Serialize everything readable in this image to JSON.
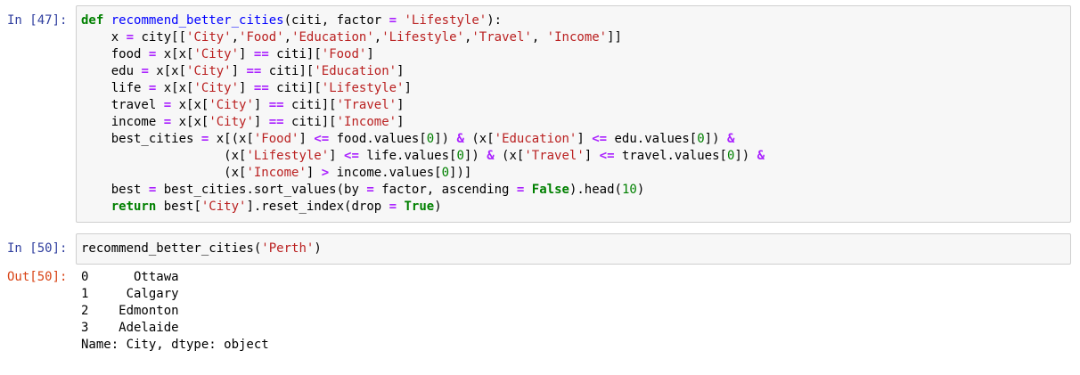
{
  "cells": [
    {
      "prompt": "In [47]:",
      "code_lines": [
        [
          {
            "t": "kw",
            "v": "def"
          },
          {
            "t": "",
            "v": " "
          },
          {
            "t": "fn",
            "v": "recommend_better_cities"
          },
          {
            "t": "",
            "v": "(citi, factor "
          },
          {
            "t": "op",
            "v": "="
          },
          {
            "t": "",
            "v": " "
          },
          {
            "t": "str",
            "v": "'Lifestyle'"
          },
          {
            "t": "",
            "v": "):"
          }
        ],
        [
          {
            "t": "",
            "v": "    x "
          },
          {
            "t": "op",
            "v": "="
          },
          {
            "t": "",
            "v": " city[["
          },
          {
            "t": "str",
            "v": "'City'"
          },
          {
            "t": "",
            "v": ","
          },
          {
            "t": "str",
            "v": "'Food'"
          },
          {
            "t": "",
            "v": ","
          },
          {
            "t": "str",
            "v": "'Education'"
          },
          {
            "t": "",
            "v": ","
          },
          {
            "t": "str",
            "v": "'Lifestyle'"
          },
          {
            "t": "",
            "v": ","
          },
          {
            "t": "str",
            "v": "'Travel'"
          },
          {
            "t": "",
            "v": ", "
          },
          {
            "t": "str",
            "v": "'Income'"
          },
          {
            "t": "",
            "v": "]]"
          }
        ],
        [
          {
            "t": "",
            "v": "    food "
          },
          {
            "t": "op",
            "v": "="
          },
          {
            "t": "",
            "v": " x[x["
          },
          {
            "t": "str",
            "v": "'City'"
          },
          {
            "t": "",
            "v": "] "
          },
          {
            "t": "op",
            "v": "=="
          },
          {
            "t": "",
            "v": " citi]["
          },
          {
            "t": "str",
            "v": "'Food'"
          },
          {
            "t": "",
            "v": "]"
          }
        ],
        [
          {
            "t": "",
            "v": "    edu "
          },
          {
            "t": "op",
            "v": "="
          },
          {
            "t": "",
            "v": " x[x["
          },
          {
            "t": "str",
            "v": "'City'"
          },
          {
            "t": "",
            "v": "] "
          },
          {
            "t": "op",
            "v": "=="
          },
          {
            "t": "",
            "v": " citi]["
          },
          {
            "t": "str",
            "v": "'Education'"
          },
          {
            "t": "",
            "v": "]"
          }
        ],
        [
          {
            "t": "",
            "v": "    life "
          },
          {
            "t": "op",
            "v": "="
          },
          {
            "t": "",
            "v": " x[x["
          },
          {
            "t": "str",
            "v": "'City'"
          },
          {
            "t": "",
            "v": "] "
          },
          {
            "t": "op",
            "v": "=="
          },
          {
            "t": "",
            "v": " citi]["
          },
          {
            "t": "str",
            "v": "'Lifestyle'"
          },
          {
            "t": "",
            "v": "]"
          }
        ],
        [
          {
            "t": "",
            "v": "    travel "
          },
          {
            "t": "op",
            "v": "="
          },
          {
            "t": "",
            "v": " x[x["
          },
          {
            "t": "str",
            "v": "'City'"
          },
          {
            "t": "",
            "v": "] "
          },
          {
            "t": "op",
            "v": "=="
          },
          {
            "t": "",
            "v": " citi]["
          },
          {
            "t": "str",
            "v": "'Travel'"
          },
          {
            "t": "",
            "v": "]"
          }
        ],
        [
          {
            "t": "",
            "v": "    income "
          },
          {
            "t": "op",
            "v": "="
          },
          {
            "t": "",
            "v": " x[x["
          },
          {
            "t": "str",
            "v": "'City'"
          },
          {
            "t": "",
            "v": "] "
          },
          {
            "t": "op",
            "v": "=="
          },
          {
            "t": "",
            "v": " citi]["
          },
          {
            "t": "str",
            "v": "'Income'"
          },
          {
            "t": "",
            "v": "]"
          }
        ],
        [
          {
            "t": "",
            "v": "    best_cities "
          },
          {
            "t": "op",
            "v": "="
          },
          {
            "t": "",
            "v": " x[(x["
          },
          {
            "t": "str",
            "v": "'Food'"
          },
          {
            "t": "",
            "v": "] "
          },
          {
            "t": "op",
            "v": "<="
          },
          {
            "t": "",
            "v": " food.values["
          },
          {
            "t": "num",
            "v": "0"
          },
          {
            "t": "",
            "v": "]) "
          },
          {
            "t": "op",
            "v": "&"
          },
          {
            "t": "",
            "v": " (x["
          },
          {
            "t": "str",
            "v": "'Education'"
          },
          {
            "t": "",
            "v": "] "
          },
          {
            "t": "op",
            "v": "<="
          },
          {
            "t": "",
            "v": " edu.values["
          },
          {
            "t": "num",
            "v": "0"
          },
          {
            "t": "",
            "v": "]) "
          },
          {
            "t": "op",
            "v": "&"
          }
        ],
        [
          {
            "t": "",
            "v": "                   (x["
          },
          {
            "t": "str",
            "v": "'Lifestyle'"
          },
          {
            "t": "",
            "v": "] "
          },
          {
            "t": "op",
            "v": "<="
          },
          {
            "t": "",
            "v": " life.values["
          },
          {
            "t": "num",
            "v": "0"
          },
          {
            "t": "",
            "v": "]) "
          },
          {
            "t": "op",
            "v": "&"
          },
          {
            "t": "",
            "v": " (x["
          },
          {
            "t": "str",
            "v": "'Travel'"
          },
          {
            "t": "",
            "v": "] "
          },
          {
            "t": "op",
            "v": "<="
          },
          {
            "t": "",
            "v": " travel.values["
          },
          {
            "t": "num",
            "v": "0"
          },
          {
            "t": "",
            "v": "]) "
          },
          {
            "t": "op",
            "v": "&"
          }
        ],
        [
          {
            "t": "",
            "v": "                   (x["
          },
          {
            "t": "str",
            "v": "'Income'"
          },
          {
            "t": "",
            "v": "] "
          },
          {
            "t": "op",
            "v": ">"
          },
          {
            "t": "",
            "v": " income.values["
          },
          {
            "t": "num",
            "v": "0"
          },
          {
            "t": "",
            "v": "])]"
          }
        ],
        [
          {
            "t": "",
            "v": "    best "
          },
          {
            "t": "op",
            "v": "="
          },
          {
            "t": "",
            "v": " best_cities.sort_values(by "
          },
          {
            "t": "op",
            "v": "="
          },
          {
            "t": "",
            "v": " factor, ascending "
          },
          {
            "t": "op",
            "v": "="
          },
          {
            "t": "",
            "v": " "
          },
          {
            "t": "kw",
            "v": "False"
          },
          {
            "t": "",
            "v": ").head("
          },
          {
            "t": "num",
            "v": "10"
          },
          {
            "t": "",
            "v": ")"
          }
        ],
        [
          {
            "t": "",
            "v": "    "
          },
          {
            "t": "kw",
            "v": "return"
          },
          {
            "t": "",
            "v": " best["
          },
          {
            "t": "str",
            "v": "'City'"
          },
          {
            "t": "",
            "v": "].reset_index(drop "
          },
          {
            "t": "op",
            "v": "="
          },
          {
            "t": "",
            "v": " "
          },
          {
            "t": "kw",
            "v": "True"
          },
          {
            "t": "",
            "v": ")"
          }
        ]
      ]
    },
    {
      "prompt": "In [50]:",
      "code_lines": [
        [
          {
            "t": "",
            "v": "recommend_better_cities("
          },
          {
            "t": "str",
            "v": "'Perth'"
          },
          {
            "t": "",
            "v": ")"
          }
        ]
      ]
    }
  ],
  "output": {
    "prompt": "Out[50]:",
    "lines": [
      "0      Ottawa",
      "1     Calgary",
      "2    Edmonton",
      "3    Adelaide",
      "Name: City, dtype: object"
    ]
  }
}
